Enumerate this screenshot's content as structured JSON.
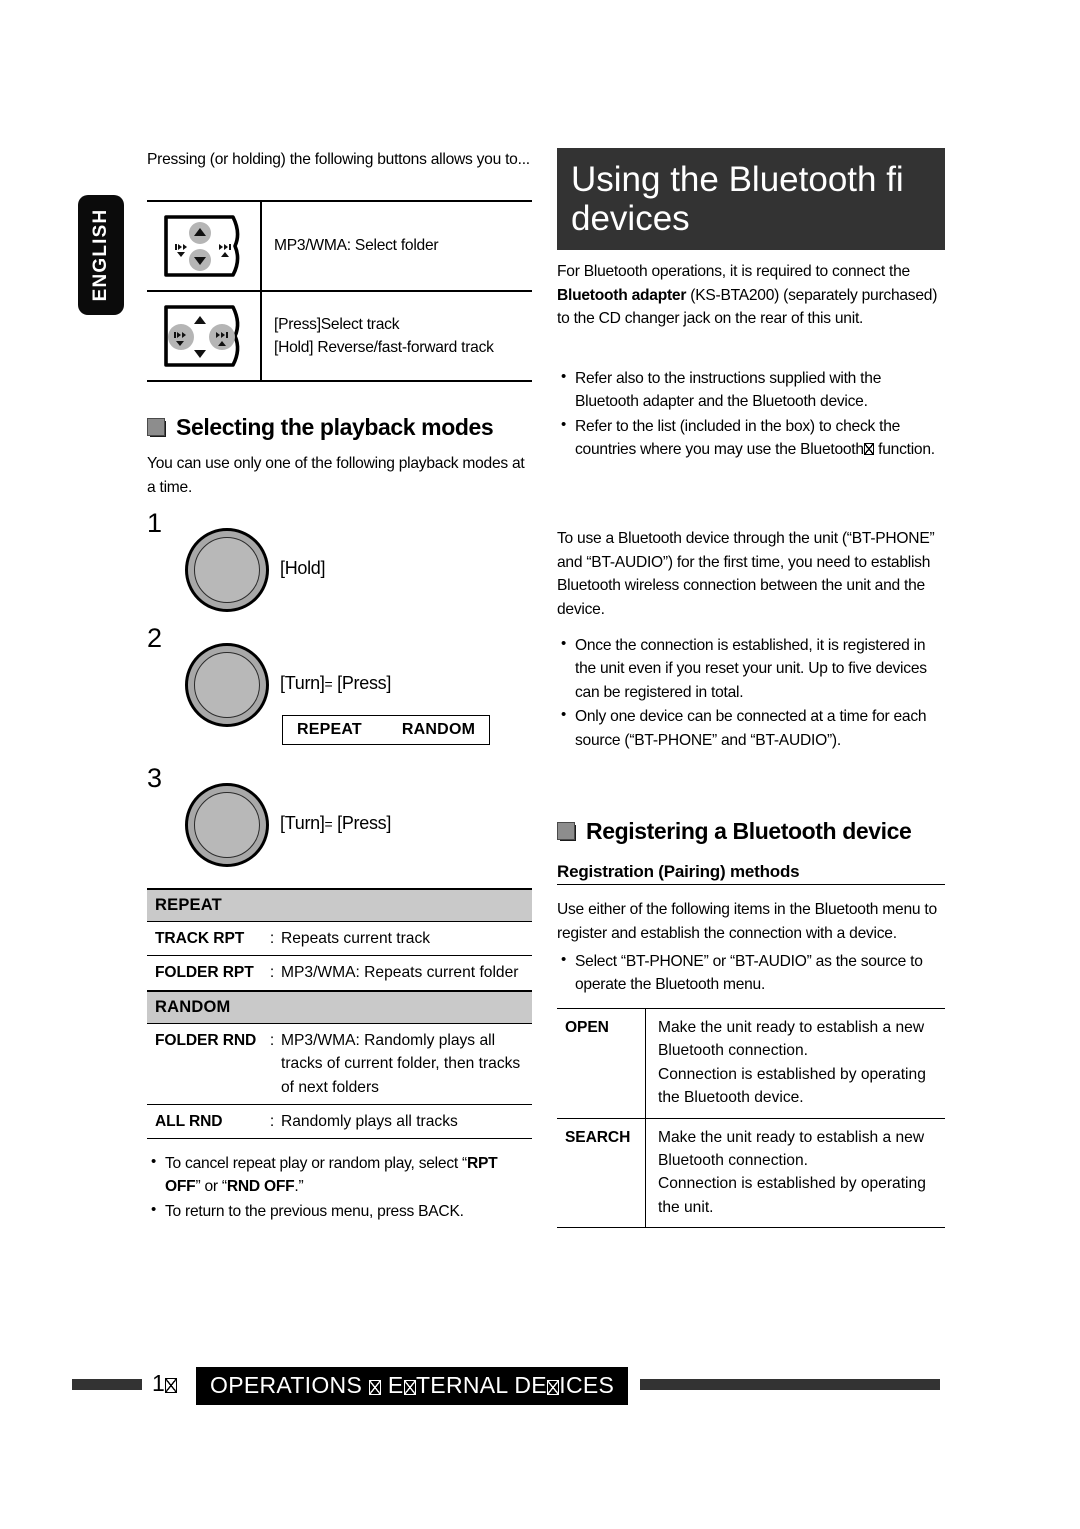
{
  "language_tab": {
    "label": "ENGLISH"
  },
  "left_column": {
    "intro_text": "Pressing (or holding) the following buttons allows you to...",
    "button_table": [
      {
        "figure": "panel-up-down-highlighted",
        "lines": [
          "MP3/WMA: Select folder"
        ]
      },
      {
        "figure": "panel-left-right-highlighted",
        "lines": [
          "[Press]Select track",
          "[Hold] Reverse/fast-forward track"
        ]
      }
    ],
    "section_heading": "Selecting the playback modes",
    "section_intro": "You can use only one of the following playback modes at a time.",
    "steps": [
      {
        "number": "1",
        "label": "[Hold]",
        "label_parts": null
      },
      {
        "number": "2",
        "label_left": "[Turn]",
        "equals": "=",
        "label_right": "[Press]"
      },
      {
        "number": "3",
        "label_left": "[Turn]",
        "equals": "=",
        "label_right": "[Press]"
      }
    ],
    "mode_badge": {
      "left": "REPEAT",
      "right": "RANDOM"
    },
    "mode_table": [
      {
        "group": "REPEAT",
        "rows": [
          {
            "key": "TRACK RPT",
            "colon": ":",
            "value": "Repeats current track"
          },
          {
            "key": "FOLDER RPT",
            "colon": ":",
            "value": "MP3/WMA: Repeats current folder"
          }
        ]
      },
      {
        "group": "RANDOM",
        "rows": [
          {
            "key": "FOLDER RND",
            "colon": ":",
            "value": "MP3/WMA: Randomly plays all tracks of current folder, then tracks of next folders"
          },
          {
            "key": "ALL RND",
            "colon": ":",
            "value": "Randomly plays all tracks"
          }
        ]
      }
    ],
    "notes": [
      {
        "pre": "To cancel repeat play or random play, select “",
        "bold1": "RPT OFF",
        "mid": "” or “",
        "bold2": "RND OFF",
        "post": ".”"
      },
      {
        "plain": "To return to the previous menu, press BACK."
      }
    ]
  },
  "right_column": {
    "banner": {
      "line1": "Using the Bluetooth fi",
      "line2": "devices"
    },
    "paragraph_1": {
      "part1": "For Bluetooth operations, it is required to connect the ",
      "bold": "Bluetooth adapter",
      "part2": " (KS-BTA200) (separately purchased) to the CD changer jack on the rear of this unit."
    },
    "bullets_1": [
      {
        "text": "Refer also to the instructions supplied with the Bluetooth adapter and the Bluetooth device."
      },
      {
        "pre": "Refer to the list (included in the box) to check the countries where you may use the Bluetooth",
        "tofu": true,
        "post": " function."
      }
    ],
    "paragraph_2": "To use a Bluetooth device through the unit (“BT-PHONE” and “BT-AUDIO”) for the first time, you need to establish Bluetooth wireless connection between the unit and the device.",
    "bullets_2": [
      {
        "text": "Once the connection is established, it is registered in the unit even if you reset your unit. Up to five devices can be registered in total."
      },
      {
        "text": "Only one device can be connected at a time for each source (“BT-PHONE” and “BT-AUDIO”)."
      }
    ],
    "section_heading": "Registering a Bluetooth device",
    "sub_heading": "Registration (Pairing) methods",
    "paragraph_3": "Use either of the following items in the Bluetooth menu to register and establish the connection with a device.",
    "bullets_3": [
      {
        "text": "Select “BT-PHONE” or “BT-AUDIO” as the source to operate the Bluetooth menu."
      }
    ],
    "methods_table": [
      {
        "key": "OPEN",
        "lines": [
          "Make the unit ready to establish a new Bluetooth connection.",
          "Connection is established by operating the Bluetooth device."
        ]
      },
      {
        "key": "SEARCH",
        "lines": [
          "Make the unit ready to establish a new Bluetooth connection.",
          "Connection is established by operating the unit."
        ]
      }
    ]
  },
  "footer": {
    "page_number_prefix": "1",
    "page_number_tofu": true,
    "chip_part1": "OPERATIONS ",
    "chip_part2": " E",
    "chip_part3": "TERNAL DE",
    "chip_part4": "ICES"
  },
  "colors": {
    "banner_bg": "#333333",
    "footer_chip_bg": "#000000",
    "table_group_bg": "#c9c9c9",
    "knob_fill": "#b0b0b0",
    "lang_tab_bg": "#0b0b0b"
  }
}
